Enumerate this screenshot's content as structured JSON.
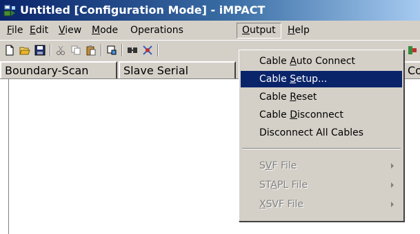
{
  "window": {
    "title": "Untitled [Configuration Mode] - iMPACT"
  },
  "menubar": {
    "items": [
      {
        "label": "File",
        "mnemonic": "F",
        "rest": "ile"
      },
      {
        "label": "Edit",
        "mnemonic": "E",
        "rest": "dit"
      },
      {
        "label": "View",
        "mnemonic": "V",
        "rest": "iew"
      },
      {
        "label": "Mode",
        "mnemonic": "M",
        "rest": "ode"
      },
      {
        "label": "Operations",
        "mnemonic": "",
        "rest": "Operations"
      },
      {
        "label": "Output",
        "mnemonic": "O",
        "rest": "utput"
      },
      {
        "label": "Help",
        "mnemonic": "H",
        "rest": "elp"
      }
    ]
  },
  "toolbar": {
    "icons": [
      "new-icon",
      "open-icon",
      "save-icon",
      "cut-icon",
      "copy-icon",
      "paste-icon",
      "program-icon",
      "chain-icon",
      "debug-icon"
    ]
  },
  "tabs": [
    {
      "label": "Boundary-Scan"
    },
    {
      "label": "Slave Serial"
    },
    {
      "label": "Cor"
    }
  ],
  "output_menu": {
    "items": [
      {
        "pre": "Cable ",
        "mn": "A",
        "post": "uto Connect",
        "state": "normal"
      },
      {
        "pre": "Cable ",
        "mn": "S",
        "post": "etup...",
        "state": "highlighted"
      },
      {
        "pre": "Cable ",
        "mn": "R",
        "post": "eset",
        "state": "normal"
      },
      {
        "pre": "Cable ",
        "mn": "D",
        "post": "isconnect",
        "state": "normal"
      },
      {
        "pre": "Disconnect All Cables",
        "mn": "",
        "post": "",
        "state": "normal"
      },
      {
        "pre": "S",
        "mn": "V",
        "post": "F File",
        "state": "disabled",
        "submenu": true
      },
      {
        "pre": "ST",
        "mn": "A",
        "post": "PL File",
        "state": "disabled",
        "submenu": true
      },
      {
        "pre": "",
        "mn": "X",
        "post": "SVF File",
        "state": "disabled",
        "submenu": true
      }
    ]
  },
  "colors": {
    "title_bar": "#0a246a",
    "menu_highlight": "#0a246a",
    "chrome": "#d4d0c8"
  }
}
